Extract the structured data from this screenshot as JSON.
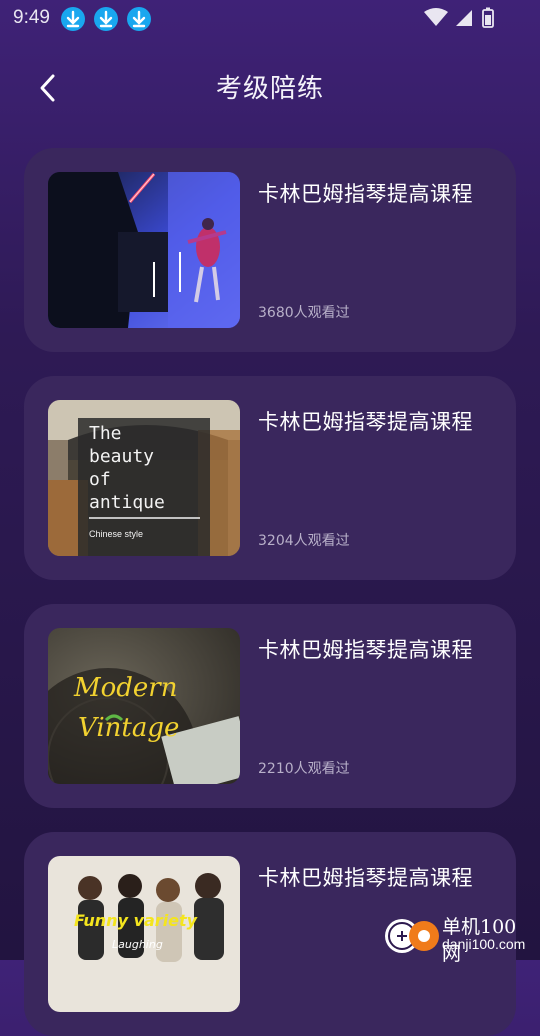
{
  "status": {
    "time": "9:49"
  },
  "header": {
    "title": "考级陪练"
  },
  "courses": [
    {
      "title": "卡林巴姆指琴提高课程",
      "views": "3680人观看过"
    },
    {
      "title": "卡林巴姆指琴提高课程",
      "views": "3204人观看过",
      "thumb_text": [
        "The",
        "beauty",
        "of",
        "antique"
      ],
      "thumb_sub": "Chinese style"
    },
    {
      "title": "卡林巴姆指琴提高课程",
      "views": "2210人观看过",
      "thumb_text": [
        "Modern",
        "Vintage"
      ]
    },
    {
      "title": "卡林巴姆指琴提高课程",
      "thumb_text": [
        "Funny variety",
        "Laughing"
      ]
    }
  ],
  "watermark": {
    "line1": "单机100网",
    "line2": "danji100.com"
  },
  "colors": {
    "accent_download": "#19a7ef",
    "card_bg": "#3a275d",
    "bg_top": "#3f2277",
    "bg_bottom": "#221440"
  }
}
